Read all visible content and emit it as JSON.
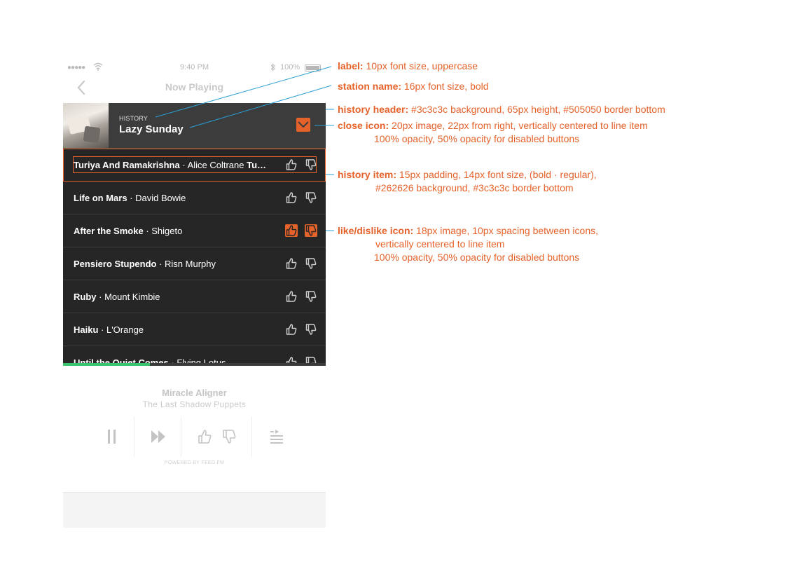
{
  "status_bar": {
    "signal": "●●●●●",
    "time": "9:40 PM",
    "battery": "100%"
  },
  "nav": {
    "title": "Now Playing"
  },
  "history": {
    "label": "History",
    "station_name": "Lazy Sunday",
    "items": [
      {
        "song": "Turiya And Ramakrishna",
        "sep": " · ",
        "artist": "Alice Coltrane",
        "extra": " Tu…",
        "liked": false,
        "disliked": false
      },
      {
        "song": "Life on Mars",
        "sep": " · ",
        "artist": "David Bowie",
        "extra": "",
        "liked": false,
        "disliked": false
      },
      {
        "song": "After the Smoke",
        "sep": " · ",
        "artist": "Shigeto",
        "extra": "",
        "liked": true,
        "disliked": true
      },
      {
        "song": "Pensiero Stupendo",
        "sep": " · ",
        "artist": "Risn Murphy",
        "extra": "",
        "liked": false,
        "disliked": false
      },
      {
        "song": "Ruby",
        "sep": " · ",
        "artist": "Mount Kimbie",
        "extra": "",
        "liked": false,
        "disliked": false
      },
      {
        "song": "Haiku",
        "sep": " · ",
        "artist": "L'Orange",
        "extra": "",
        "liked": false,
        "disliked": false
      },
      {
        "song": "Until the Quiet Comes",
        "sep": " · ",
        "artist": "Flying Lotus",
        "extra": "",
        "liked": false,
        "disliked": false
      }
    ],
    "progress": 0.33
  },
  "player": {
    "track_title": "Miracle Aligner",
    "track_artist": "The Last Shadow Puppets",
    "powered_by": "POWERED BY FEED.FM"
  },
  "annotations": {
    "label": {
      "title": "label:",
      "text": " 10px font size, uppercase"
    },
    "station": {
      "title": "station name:",
      "text": " 16px font size, bold"
    },
    "header": {
      "title": "history header:",
      "text": " #3c3c3c background, 65px height, #505050 border bottom"
    },
    "close": {
      "title": "close icon:",
      "text": " 20px image, 22px from right, vertically centered to line item",
      "line2": "100% opacity, 50% opacity for disabled buttons"
    },
    "item": {
      "title": "history item:",
      "text": " 15px padding, 14px font size, (bold · regular),",
      "line2": "#262626 background, #3c3c3c border bottom"
    },
    "like": {
      "title": "like/dislike icon:",
      "text": " 18px image, 10px spacing between icons,",
      "line2": "vertically centered to line item",
      "line3": "100% opacity, 50% opacity for disabled buttons"
    }
  },
  "colors": {
    "accent": "#e5622a",
    "header_bg": "#3c3c3c",
    "list_bg": "#262626",
    "annot_line": "#2a9fd6",
    "progress": "#3ac36e"
  }
}
